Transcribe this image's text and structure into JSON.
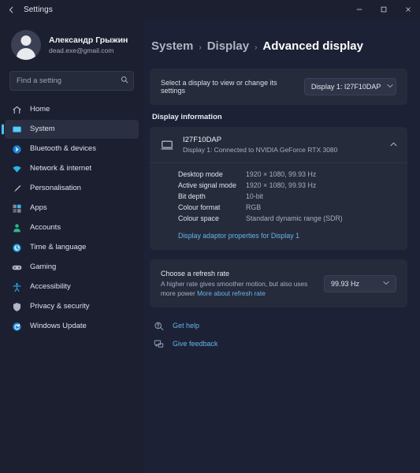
{
  "titlebar": {
    "back_label": "←",
    "title": "Settings",
    "minimize": "─",
    "maximize": "□",
    "close": "✕"
  },
  "sidebar": {
    "account": {
      "name": "Александр Грыжин",
      "email": "dead.exe@gmail.com"
    },
    "search": {
      "placeholder": "Find a setting",
      "value": "",
      "icon": "search-icon"
    },
    "items": [
      {
        "label": "Home",
        "icon": "home-icon",
        "selected": false
      },
      {
        "label": "System",
        "icon": "system-icon",
        "selected": true
      },
      {
        "label": "Bluetooth & devices",
        "icon": "bluetooth-icon",
        "selected": false
      },
      {
        "label": "Network & internet",
        "icon": "wifi-icon",
        "selected": false
      },
      {
        "label": "Personalisation",
        "icon": "paintbrush-icon",
        "selected": false
      },
      {
        "label": "Apps",
        "icon": "apps-icon",
        "selected": false
      },
      {
        "label": "Accounts",
        "icon": "account-icon",
        "selected": false
      },
      {
        "label": "Time & language",
        "icon": "clock-icon",
        "selected": false
      },
      {
        "label": "Gaming",
        "icon": "gamepad-icon",
        "selected": false
      },
      {
        "label": "Accessibility",
        "icon": "accessibility-icon",
        "selected": false
      },
      {
        "label": "Privacy & security",
        "icon": "shield-icon",
        "selected": false
      },
      {
        "label": "Windows Update",
        "icon": "update-icon",
        "selected": false
      }
    ]
  },
  "main": {
    "breadcrumb": {
      "first": "System",
      "second": "Display",
      "current": "Advanced display",
      "separator": "›"
    },
    "display_select": {
      "label": "Select a display to view or change its settings",
      "value": "Display 1: I27F10DAP",
      "chevron": "⌄"
    },
    "display_information": {
      "section_title": "Display information",
      "monitor_name": "I27F10DAP",
      "monitor_sub": "Display 1: Connected to NVIDIA GeForce RTX 3080",
      "collapse_chevron": "⌃",
      "details": [
        {
          "key": "Desktop mode",
          "value": "1920 × 1080, 99.93 Hz"
        },
        {
          "key": "Active signal mode",
          "value": "1920 × 1080, 99.93 Hz"
        },
        {
          "key": "Bit depth",
          "value": "10-bit"
        },
        {
          "key": "Colour format",
          "value": "RGB"
        },
        {
          "key": "Colour space",
          "value": "Standard dynamic range (SDR)"
        }
      ],
      "adaptor_link": "Display adaptor properties for Display 1"
    },
    "refresh_rate": {
      "title": "Choose a refresh rate",
      "description": "A higher rate gives smoother motion, but also uses more power",
      "more_link": "More about refresh rate",
      "value": "99.93 Hz",
      "chevron": "⌄"
    },
    "footer": {
      "get_help": "Get help",
      "give_feedback": "Give feedback"
    }
  },
  "colors": {
    "accent": "#4cc2ff",
    "link": "#63b6e8",
    "window_bg": "#1d2135",
    "sidebar_bg": "#1b1f30",
    "card_bg": "#262b3c"
  }
}
